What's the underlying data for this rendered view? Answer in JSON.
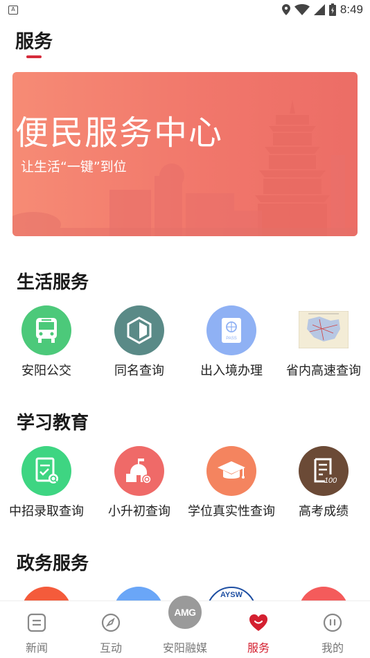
{
  "status_bar": {
    "notification_icon": "A",
    "time": "8:49",
    "icons": [
      "location-icon",
      "wifi-icon",
      "signal-icon",
      "battery-icon"
    ]
  },
  "header": {
    "title": "服务"
  },
  "banner": {
    "title": "便民服务中心",
    "subtitle": "让生活“一键”到位"
  },
  "sections": {
    "life": {
      "title": "生活服务",
      "items": [
        {
          "label": "安阳公交",
          "icon": "bus-icon",
          "color": "#4cc97a"
        },
        {
          "label": "同名查询",
          "icon": "shield-icon",
          "color": "#5a8a87"
        },
        {
          "label": "出入境办理",
          "icon": "passport-icon",
          "color": "#8fb1f4"
        },
        {
          "label": "省内高速查询",
          "icon": "map-icon",
          "color": "#f3ecd6"
        }
      ]
    },
    "education": {
      "title": "学习教育",
      "items": [
        {
          "label": "中招录取查询",
          "icon": "document-check-icon",
          "color": "#3ed582"
        },
        {
          "label": "小升初查询",
          "icon": "school-icon",
          "color": "#ef6a68"
        },
        {
          "label": "学位真实性查询",
          "icon": "graduation-cap-icon",
          "color": "#f4845f"
        },
        {
          "label": "高考成绩",
          "icon": "score-paper-icon",
          "color": "#6b4a36"
        }
      ]
    },
    "government": {
      "title": "政务服务",
      "partial_items": [
        {
          "icon": "government-item-1-icon",
          "color": "#f45b3b"
        },
        {
          "icon": "government-item-2-icon",
          "color": "#6aa6f7"
        },
        {
          "icon": "government-item-3-icon",
          "color": "#ffffff",
          "text": "AYSW"
        },
        {
          "icon": "government-item-4-icon",
          "color": "#f45b5b"
        }
      ]
    }
  },
  "tab_bar": {
    "tabs": [
      {
        "label": "新闻",
        "icon": "news-icon"
      },
      {
        "label": "互动",
        "icon": "compass-icon"
      },
      {
        "label": "安阳融媒",
        "icon": "logo-icon"
      },
      {
        "label": "服务",
        "icon": "heart-icon",
        "active": true
      },
      {
        "label": "我的",
        "icon": "profile-icon"
      }
    ],
    "center_logo_text": "AMG",
    "active_color": "#d42030"
  }
}
